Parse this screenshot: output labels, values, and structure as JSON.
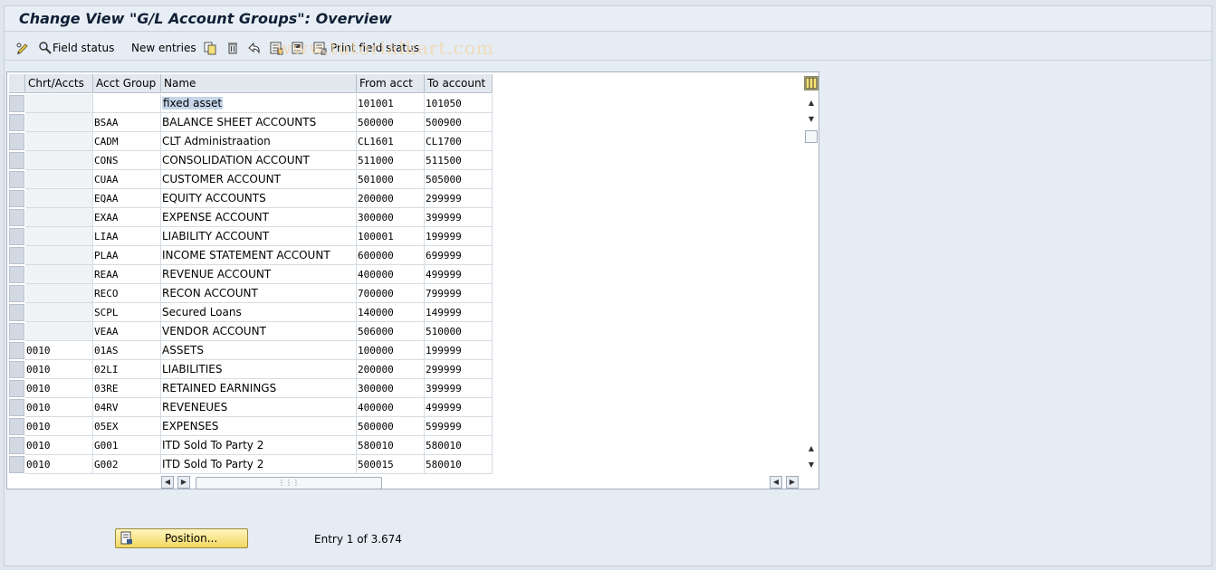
{
  "title": "Change View \"G/L Account Groups\": Overview",
  "toolbar": {
    "field_status_label": "Field status",
    "new_entries_label": "New entries",
    "print_field_status_label": "Print field status"
  },
  "watermark": "www.tutorialkart.com",
  "table": {
    "headers": [
      "Chrt/Accts",
      "Acct Group",
      "Name",
      "From acct",
      "To account"
    ],
    "rows": [
      {
        "chart": "",
        "group": "",
        "name": "fixed asset",
        "from": "101001",
        "to": "101050"
      },
      {
        "chart": "",
        "group": "BSAA",
        "name": "BALANCE SHEET ACCOUNTS",
        "from": "500000",
        "to": "500900"
      },
      {
        "chart": "",
        "group": "CADM",
        "name": "CLT Administraation",
        "from": "CL1601",
        "to": "CL1700"
      },
      {
        "chart": "",
        "group": "CONS",
        "name": "CONSOLIDATION ACCOUNT",
        "from": "511000",
        "to": "511500"
      },
      {
        "chart": "",
        "group": "CUAA",
        "name": "CUSTOMER ACCOUNT",
        "from": "501000",
        "to": "505000"
      },
      {
        "chart": "",
        "group": "EQAA",
        "name": "EQUITY ACCOUNTS",
        "from": "200000",
        "to": "299999"
      },
      {
        "chart": "",
        "group": "EXAA",
        "name": "EXPENSE ACCOUNT",
        "from": "300000",
        "to": "399999"
      },
      {
        "chart": "",
        "group": "LIAA",
        "name": "LIABILITY ACCOUNT",
        "from": "100001",
        "to": "199999"
      },
      {
        "chart": "",
        "group": "PLAA",
        "name": "INCOME STATEMENT ACCOUNT",
        "from": "600000",
        "to": "699999"
      },
      {
        "chart": "",
        "group": "REAA",
        "name": "REVENUE ACCOUNT",
        "from": "400000",
        "to": "499999"
      },
      {
        "chart": "",
        "group": "RECO",
        "name": "RECON ACCOUNT",
        "from": "700000",
        "to": "799999"
      },
      {
        "chart": "",
        "group": "SCPL",
        "name": "Secured Loans",
        "from": "140000",
        "to": "149999"
      },
      {
        "chart": "",
        "group": "VEAA",
        "name": "VENDOR ACCOUNT",
        "from": "506000",
        "to": "510000"
      },
      {
        "chart": "0010",
        "group": "01AS",
        "name": "ASSETS",
        "from": "100000",
        "to": "199999"
      },
      {
        "chart": "0010",
        "group": "02LI",
        "name": "LIABILITIES",
        "from": "200000",
        "to": "299999"
      },
      {
        "chart": "0010",
        "group": "03RE",
        "name": "RETAINED EARNINGS",
        "from": "300000",
        "to": "399999"
      },
      {
        "chart": "0010",
        "group": "04RV",
        "name": "REVENEUES",
        "from": "400000",
        "to": "499999"
      },
      {
        "chart": "0010",
        "group": "05EX",
        "name": "EXPENSES",
        "from": "500000",
        "to": "599999"
      },
      {
        "chart": "0010",
        "group": "G001",
        "name": "ITD Sold To Party 2",
        "from": "580010",
        "to": "580010"
      },
      {
        "chart": "0010",
        "group": "G002",
        "name": "ITD Sold To Party 2",
        "from": "500015",
        "to": "580010"
      }
    ]
  },
  "footer": {
    "position_label": "Position...",
    "entry_text": "Entry 1 of 3.674"
  },
  "colors": {
    "background": "#dfe6ef",
    "selection": "#c5d6ea",
    "button": "#f2d760"
  }
}
